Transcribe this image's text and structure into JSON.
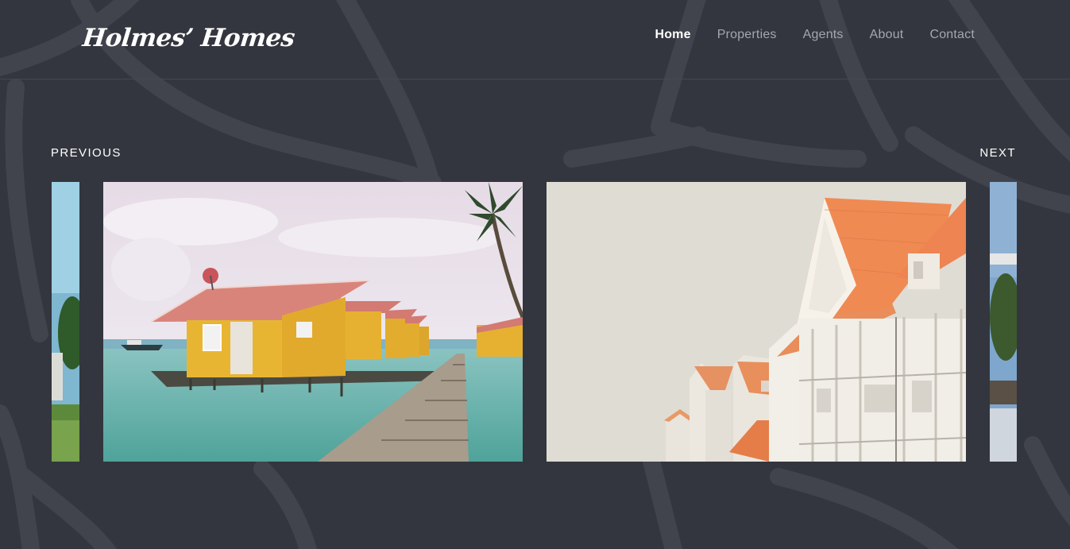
{
  "header": {
    "logo": "Holmes’ Homes",
    "nav": [
      {
        "label": "Home",
        "active": true
      },
      {
        "label": "Properties",
        "active": false
      },
      {
        "label": "Agents",
        "active": false
      },
      {
        "label": "About",
        "active": false
      },
      {
        "label": "Contact",
        "active": false
      }
    ]
  },
  "slider": {
    "previous_label": "PREVIOUS",
    "next_label": "NEXT"
  },
  "colors": {
    "background": "#33363e",
    "nav_inactive": "#a4a7ae",
    "text": "#ffffff"
  }
}
